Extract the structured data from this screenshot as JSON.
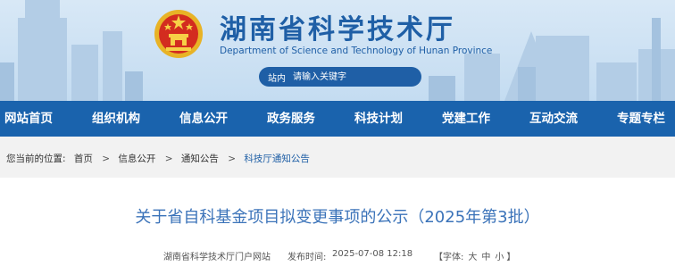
{
  "header": {
    "title": "湖南省科学技术厅",
    "subtitle": "Department of Science and Technology of Hunan Province",
    "search": {
      "scope": "站内",
      "placeholder": "请输入关键字"
    }
  },
  "nav": [
    "网站首页",
    "组织机构",
    "信息公开",
    "政务服务",
    "科技计划",
    "党建工作",
    "互动交流",
    "专题专栏"
  ],
  "breadcrumb": {
    "label": "您当前的位置:",
    "items": [
      "首页",
      "信息公开",
      "通知公告",
      "科技厅通知公告"
    ],
    "separator": ">"
  },
  "article": {
    "title": "关于省自科基金项目拟变更事项的公示（2025年第3批）",
    "source": "湖南省科学技术厅门户网站",
    "date_label": "发布时间:",
    "date": "2025-07-08 12:18",
    "font_label": "【字体:",
    "font_sizes": [
      "大",
      "中",
      "小"
    ],
    "font_close": "】"
  },
  "colors": {
    "brand": "#1f5fa6",
    "nav": "#1a63ad",
    "title": "#3b73b9"
  }
}
